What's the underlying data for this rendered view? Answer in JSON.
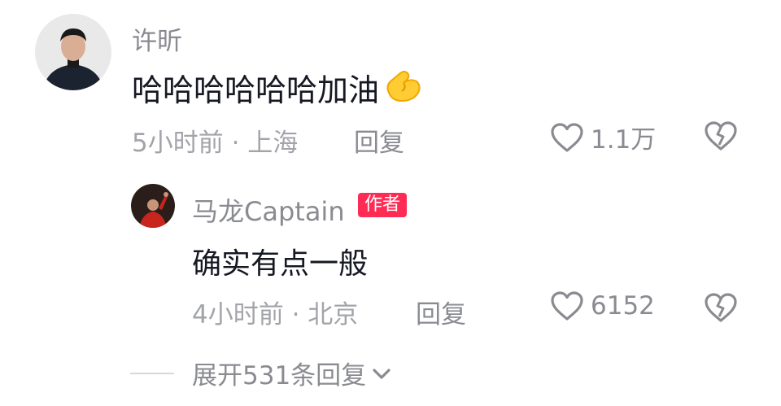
{
  "comment": {
    "username": "许昕",
    "text": "哈哈哈哈哈哈加油",
    "emoji": "💪",
    "time_location": "5小时前 · 上海",
    "reply_label": "回复",
    "like_count": "1.1万"
  },
  "reply": {
    "username": "马龙Captain",
    "badge": "作者",
    "text": "确实有点一般",
    "time_location": "4小时前 · 北京",
    "reply_label": "回复",
    "like_count": "6152"
  },
  "expand_label": "展开531条回复",
  "icons": {
    "like": "heart-outline-icon",
    "dislike": "broken-heart-icon",
    "expand": "chevron-down-icon"
  },
  "colors": {
    "badge": "#fe2c55",
    "text": "#161823",
    "muted": "#8a8b91"
  }
}
